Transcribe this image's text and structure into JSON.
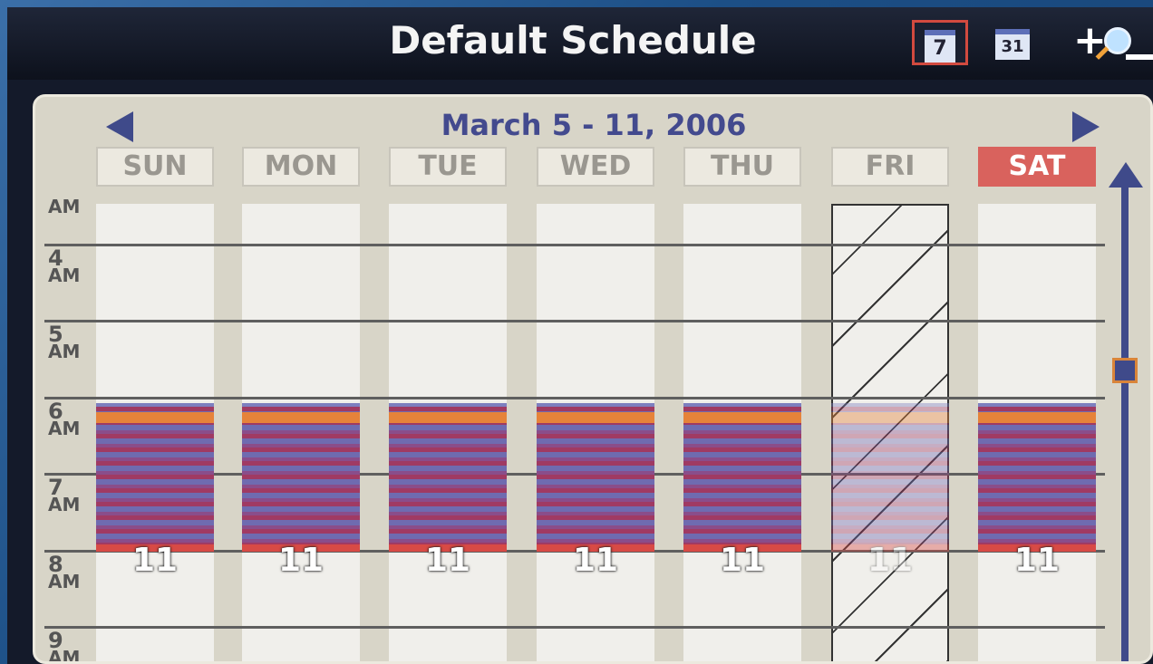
{
  "window": {
    "title": "Default Schedule"
  },
  "toolbar": {
    "week_view_label": "7",
    "month_view_label": "31"
  },
  "navigation": {
    "date_range": "March 5 - 11, 2006"
  },
  "days": [
    {
      "label": "SUN",
      "active": false,
      "excluded": false
    },
    {
      "label": "MON",
      "active": false,
      "excluded": false
    },
    {
      "label": "TUE",
      "active": false,
      "excluded": false
    },
    {
      "label": "WED",
      "active": false,
      "excluded": false
    },
    {
      "label": "THU",
      "active": false,
      "excluded": false
    },
    {
      "label": "FRI",
      "active": false,
      "excluded": true
    },
    {
      "label": "SAT",
      "active": true,
      "excluded": false
    }
  ],
  "hours": [
    {
      "num": "",
      "ampm": "AM"
    },
    {
      "num": "4",
      "ampm": "AM"
    },
    {
      "num": "5",
      "ampm": "AM"
    },
    {
      "num": "6",
      "ampm": "AM"
    },
    {
      "num": "7",
      "ampm": "AM"
    },
    {
      "num": "8",
      "ampm": "AM"
    },
    {
      "num": "9",
      "ampm": "AM"
    }
  ],
  "events": {
    "stack_label": "11"
  },
  "colors": {
    "accent": "#434a8e",
    "today": "#d9625d",
    "selected_border": "#d24a3f"
  }
}
